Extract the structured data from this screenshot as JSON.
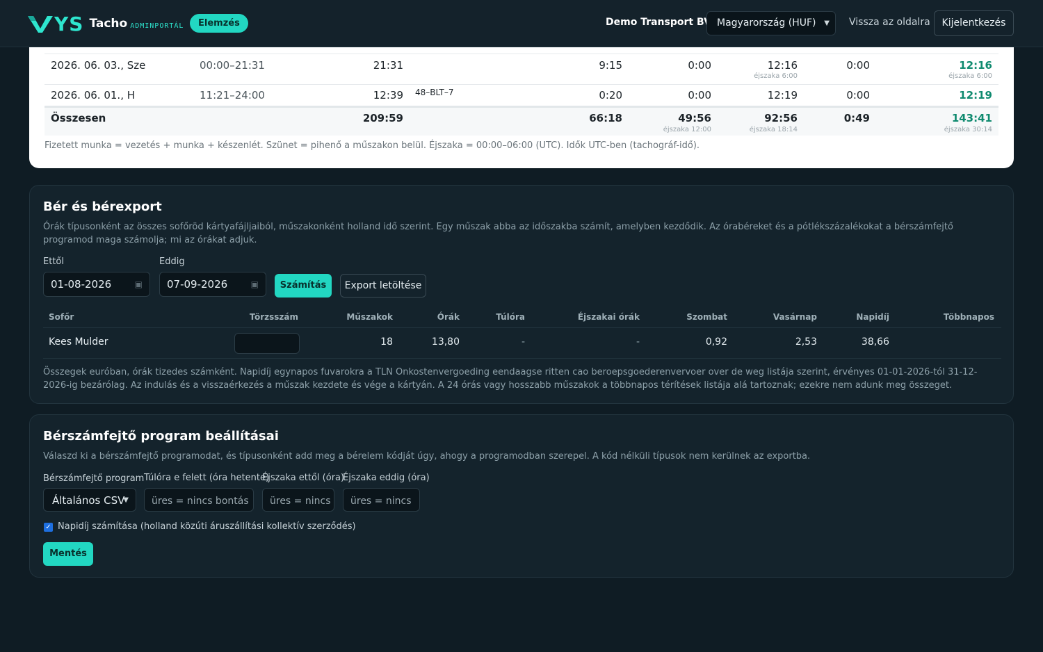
{
  "header": {
    "logo_mark": "YS",
    "logo_tacho": "Tacho",
    "logo_admin": "ADMINPORTÁL",
    "elemzes_badge": "Elemzés",
    "company": "Demo Transport BV",
    "country_select": "Magyarország (HUF)",
    "back_link": "Vissza az oldalra",
    "logout": "Kijelentkezés"
  },
  "summary": {
    "rows": [
      {
        "date": "2026. 06. 03., Sze",
        "range": "00:00–21:31",
        "total": "21:31",
        "plate": "",
        "c4": "9:15",
        "c5": "0:00",
        "c6": "12:16",
        "c6_sub": "éjszaka 6:00",
        "c7": "0:00",
        "c8": "12:16",
        "c8_sub": "éjszaka 6:00"
      },
      {
        "date": "2026. 06. 01., H",
        "range": "11:21–24:00",
        "total": "12:39",
        "plate": "48–BLT–7",
        "c4": "0:20",
        "c5": "0:00",
        "c6": "12:19",
        "c6_sub": "",
        "c7": "0:00",
        "c8": "12:19",
        "c8_sub": ""
      }
    ],
    "total": {
      "label": "Összesen",
      "total": "209:59",
      "c4": "66:18",
      "c5": "49:56",
      "c5_sub": "éjszaka 12:00",
      "c6": "92:56",
      "c6_sub": "éjszaka 18:14",
      "c7": "0:49",
      "c8": "143:41",
      "c8_sub": "éjszaka 30:14"
    },
    "note": "Fizetett munka = vezetés + munka + készenlét. Szünet = pihenő a műszakon belül. Éjszaka = 00:00–06:00 (UTC). Idők UTC-ben (tachográf-idő)."
  },
  "payroll": {
    "title": "Bér és bérexport",
    "description": "Órák típusonként az összes sofőröd kártyafájljaiból, műszakonként holland idő szerint. Egy műszak abba az időszakba számít, amelyben kezdődik. Az órabéreket és a pótlékszázalékokat a bérszámfejtő programod maga számolja; mi az órákat adjuk.",
    "from_label": "Ettől",
    "from_value": "01-08-2026",
    "to_label": "Eddig",
    "to_value": "07-09-2026",
    "calc_button": "Számítás",
    "export_button": "Export letöltése",
    "columns": [
      "Sofőr",
      "Törzsszám",
      "Műszakok",
      "Órák",
      "Túlóra",
      "Éjszakai órák",
      "Szombat",
      "Vasárnap",
      "Napidíj",
      "Többnapos"
    ],
    "row": {
      "driver": "Kees Mulder",
      "shifts": "18",
      "hours": "13,80",
      "overtime": "-",
      "night": "-",
      "saturday": "0,92",
      "sunday": "2,53",
      "per_diem": "38,66",
      "multiday": ""
    },
    "note": "Összegek euróban, órák tizedes számként. Napidíj egynapos fuvarokra a TLN Onkostenvergoeding eendaagse ritten cao beroepsgoederenvervoer over de weg listája szerint, érvényes 01-01-2026-tól 31-12-2026-ig bezárólag. Az indulás és a visszaérkezés a műszak kezdete és vége a kártyán. A 24 órás vagy hosszabb műszakok a többnapos térítések listája alá tartoznak; ezekre nem adunk meg összeget."
  },
  "settings": {
    "title": "Bérszámfejtő program beállításai",
    "description": "Válaszd ki a bérszámfejtő programodat, és típusonként add meg a bérelem kódját úgy, ahogy a programodban szerepel. A kód nélküli típusok nem kerülnek az exportba.",
    "program_label": "Bérszámfejtő program",
    "program_value": "Általános CSV",
    "overtime_label": "Túlóra e felett (óra hetente)",
    "overtime_placeholder": "üres = nincs bontás",
    "night_from_label": "Éjszaka ettől (óra)",
    "night_from_placeholder": "üres = nincs",
    "night_to_label": "Éjszaka eddig (óra)",
    "night_to_placeholder": "üres = nincs",
    "perdiem_checkbox": "Napidíj számítása (holland közúti áruszállítási kollektív szerződés)",
    "save_button": "Mentés"
  }
}
